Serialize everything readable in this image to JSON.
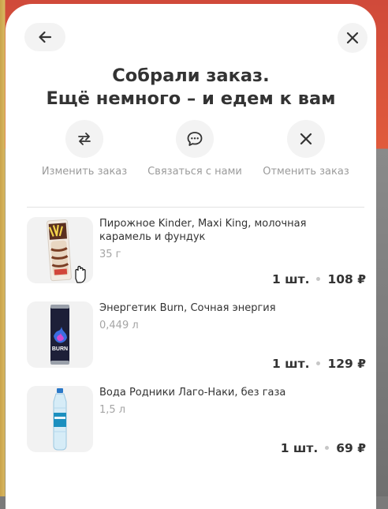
{
  "header": {
    "title_line1": "Собрали заказ.",
    "title_line2": "Ещё немного – и едем к вам"
  },
  "actions": [
    {
      "label": "Изменить заказ",
      "icon": "swap-arrows-icon"
    },
    {
      "label": "Связаться с нами",
      "icon": "chat-bubble-icon"
    },
    {
      "label": "Отменить заказ",
      "icon": "close-icon"
    }
  ],
  "items": [
    {
      "name": "Пирожное Kinder, Maxi King, молочная карамель и фундук",
      "weight": "35 г",
      "qty": "1 шт.",
      "price": "108 ₽"
    },
    {
      "name": "Энергетик Burn, Сочная энергия",
      "weight": "0,449 л",
      "qty": "1 шт.",
      "price": "129 ₽"
    },
    {
      "name": "Вода Родники Лаго-Наки, без газа",
      "weight": "1,5 л",
      "qty": "1 шт.",
      "price": "69 ₽"
    }
  ],
  "colors": {
    "text": "#333333",
    "muted": "#9b9b9b",
    "button_bg": "#f3f3f3"
  }
}
